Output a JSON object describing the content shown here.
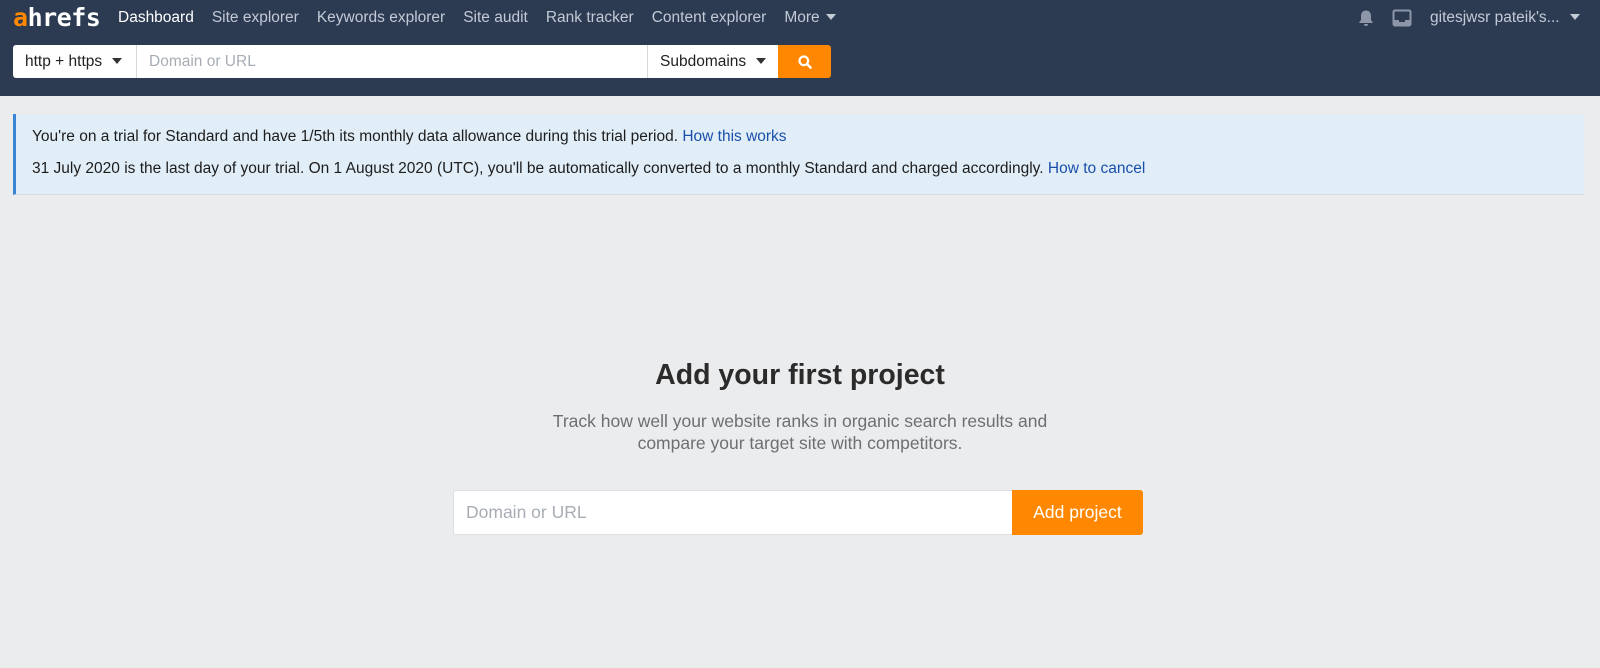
{
  "header": {
    "logo_first": "a",
    "logo_rest": "hrefs",
    "nav": [
      {
        "label": "Dashboard",
        "active": true
      },
      {
        "label": "Site explorer"
      },
      {
        "label": "Keywords explorer"
      },
      {
        "label": "Site audit"
      },
      {
        "label": "Rank tracker"
      },
      {
        "label": "Content explorer"
      },
      {
        "label": "More"
      }
    ],
    "user_label": "gitesjwsr pateik's...",
    "icons": [
      "bell-icon",
      "inbox-icon"
    ]
  },
  "search": {
    "protocol": "http + https",
    "placeholder": "Domain or URL",
    "mode": "Subdomains",
    "button_icon": "search-icon"
  },
  "banner": {
    "line1": "You're on a trial for Standard and have 1/5th its monthly data allowance during this trial period.",
    "link1": "How this works",
    "line2": "31 July 2020 is the last day of your trial. On 1 August 2020 (UTC), you'll be automatically converted to a monthly Standard and charged accordingly.",
    "link2": "How to cancel"
  },
  "main": {
    "title": "Add your first project",
    "subtitle_1": "Track how well your website ranks in organic search results and",
    "subtitle_2": "compare your target site with competitors.",
    "input_placeholder": "Domain or URL",
    "button": "Add project"
  },
  "colors": {
    "header_bg": "#2c3a52",
    "accent": "#ff8800",
    "banner_bg": "#e1eef8",
    "link": "#1a4fa8",
    "page_bg": "#ebecee"
  }
}
